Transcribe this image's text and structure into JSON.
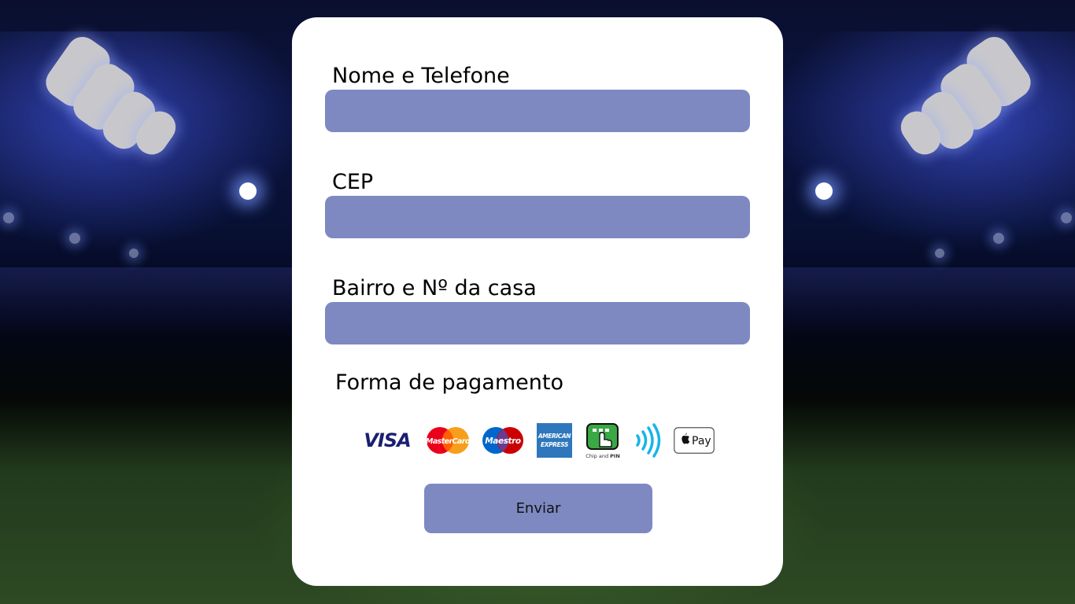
{
  "form": {
    "name_phone_label": "Nome e Telefone",
    "name_phone_value": "",
    "cep_label": "CEP",
    "cep_value": "",
    "address_label": "Bairro e Nº da casa",
    "address_value": "",
    "payment_label": "Forma de pagamento",
    "submit_label": "Enviar"
  },
  "payment_methods": {
    "visa": "VISA",
    "mastercard": "MasterCard",
    "maestro": "Maestro",
    "amex_line1": "AMERICAN",
    "amex_line2": "EXPRESS",
    "chip_pin_prefix": "Chip and ",
    "chip_pin_bold": "PIN",
    "applepay": "Pay"
  },
  "colors": {
    "field_fill": "#7e89c1",
    "card_bg": "#ffffff",
    "visa_blue": "#1a1f71",
    "mastercard_red": "#eb001b",
    "mastercard_orange": "#f79e1b",
    "maestro_blue": "#0066cb",
    "amex_blue": "#2e77bc",
    "chip_green": "#3aa845",
    "contactless_cyan": "#18b4e8"
  }
}
